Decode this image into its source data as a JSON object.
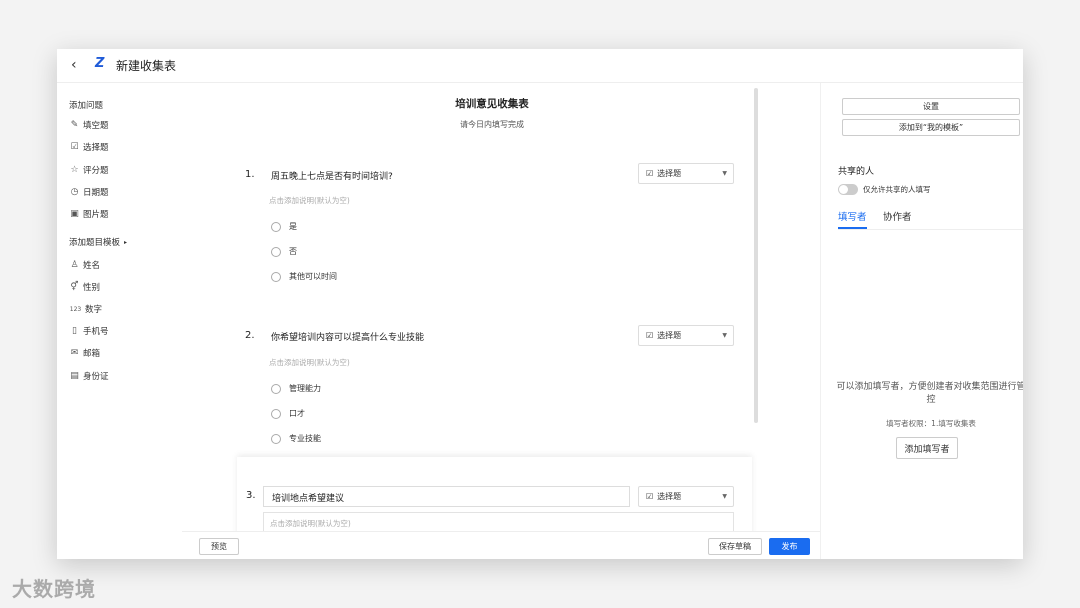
{
  "app": {
    "title": "新建收集表",
    "logo": "Z"
  },
  "sidebar": {
    "section_questions": "添加问题",
    "questions": [
      {
        "icon": "pencil-icon",
        "label": "填空题"
      },
      {
        "icon": "checkbox-icon",
        "label": "选择题"
      },
      {
        "icon": "star-icon",
        "label": "评分题"
      },
      {
        "icon": "clock-icon",
        "label": "日期题"
      },
      {
        "icon": "image-icon",
        "label": "图片题"
      }
    ],
    "section_templates": "添加题目模板",
    "templates": [
      {
        "icon": "user-icon",
        "label": "姓名"
      },
      {
        "icon": "gender-icon",
        "label": "性别"
      },
      {
        "icon": "number-icon",
        "icon_text": "123",
        "label": "数字"
      },
      {
        "icon": "phone-icon",
        "label": "手机号"
      },
      {
        "icon": "mail-icon",
        "label": "邮箱"
      },
      {
        "icon": "id-card-icon",
        "label": "身份证"
      }
    ]
  },
  "form": {
    "title": "培训意见收集表",
    "subtitle": "请今日内填写完成",
    "hint": "点击添加说明(默认为空)",
    "questions": [
      {
        "number": "1.",
        "text": "周五晚上七点是否有时间培训?",
        "type": "选择题",
        "options": [
          "是",
          "否",
          "其他可以时间"
        ]
      },
      {
        "number": "2.",
        "text": "你希望培训内容可以提高什么专业技能",
        "type": "选择题",
        "options": [
          "管理能力",
          "口才",
          "专业技能"
        ]
      },
      {
        "number": "3.",
        "text": "培训地点希望建议",
        "type": "选择题"
      }
    ]
  },
  "bottom": {
    "preview": "预览",
    "save_draft": "保存草稿",
    "publish": "发布"
  },
  "right": {
    "settings": "设置",
    "add_template": "添加到“我的模板”",
    "share_title": "共享的人",
    "toggle_label": "仅允许共享的人填写",
    "tabs": [
      "填写者",
      "协作者"
    ],
    "empty_text": "可以添加填写者，方便创建者对收集范围进行管控",
    "permission": "填写者权限：1.填写收集表",
    "add_filler": "添加填写者"
  },
  "watermark": "大数跨境",
  "colors": {
    "accent": "#1a6cf0"
  }
}
